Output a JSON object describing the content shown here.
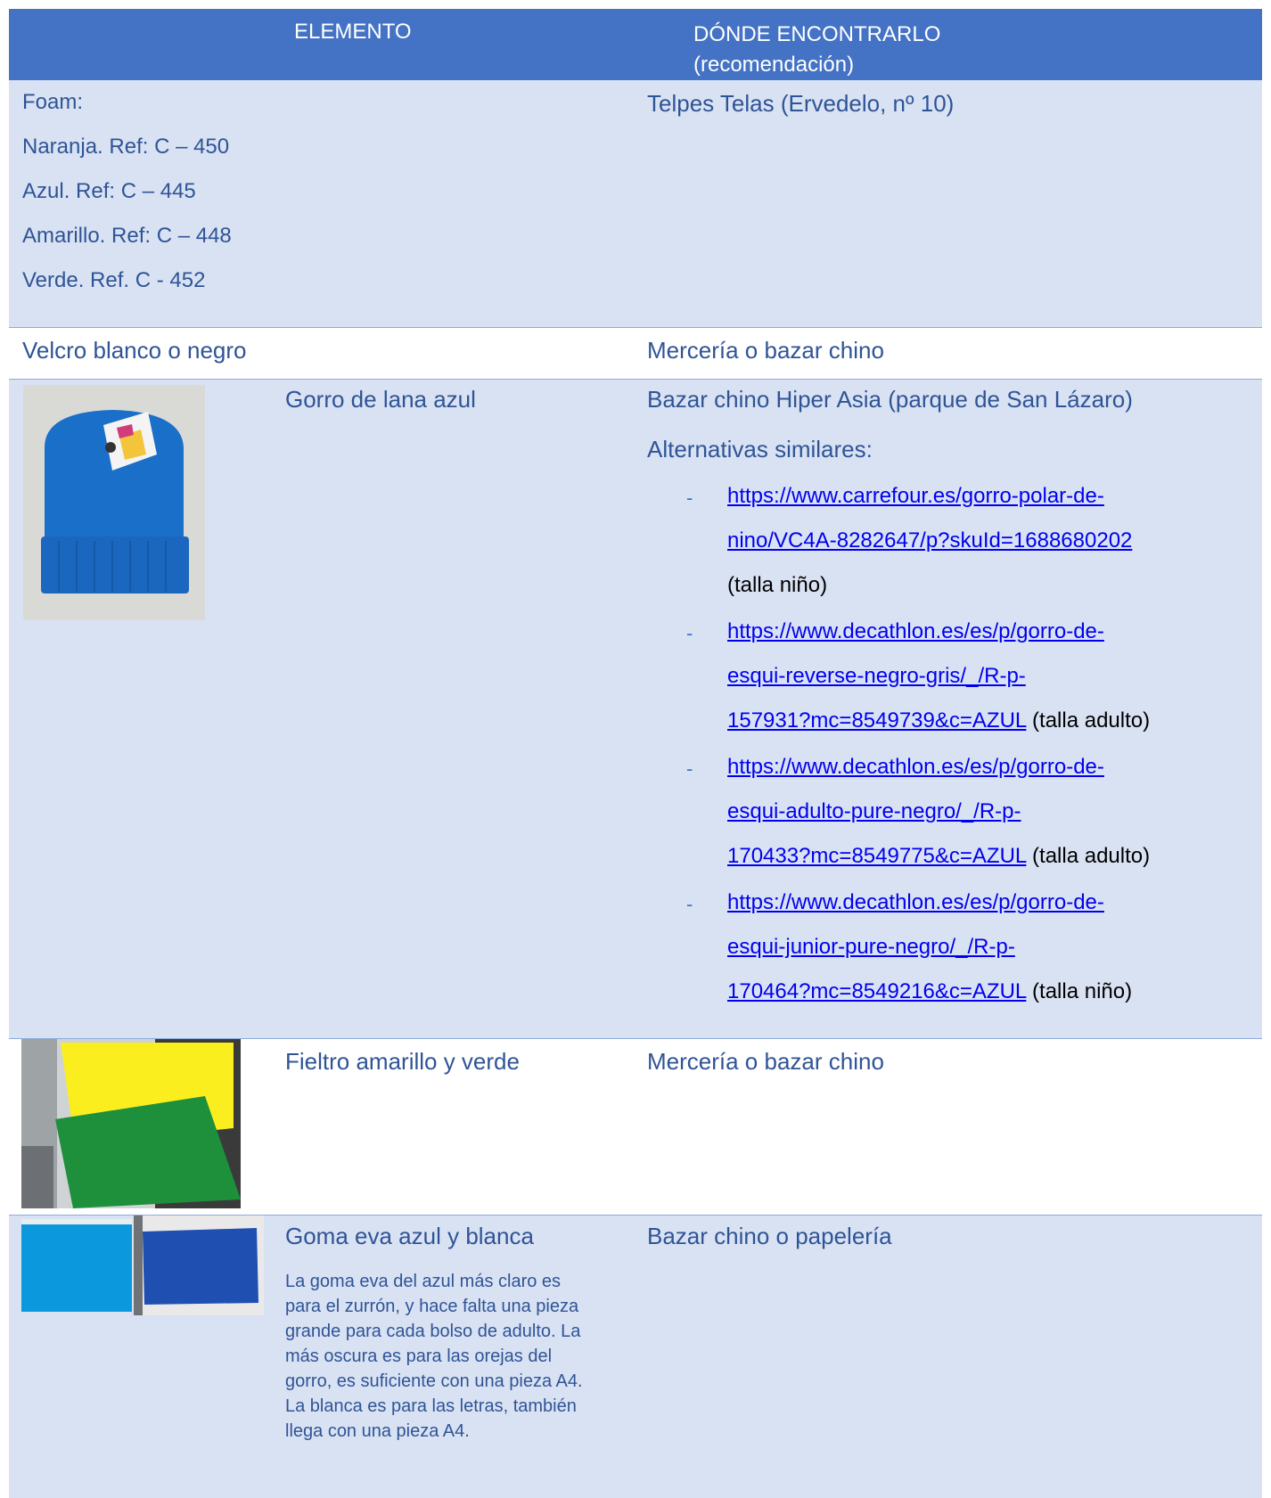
{
  "header": {
    "col1": "ELEMENTO",
    "col2_line1": "DÓNDE ENCONTRARLO",
    "col2_line2": "(recomendación)"
  },
  "foam": {
    "title": "Foam:",
    "items": [
      "Naranja. Ref: C – 450",
      "Azul. Ref: C – 445",
      "Amarillo. Ref: C – 448",
      "Verde. Ref. C - 452"
    ],
    "where": "Telpes Telas (Ervedelo, nº 10)"
  },
  "velcro": {
    "name": "Velcro blanco o negro",
    "where": "Mercería o bazar chino"
  },
  "gorro": {
    "name": "Gorro de lana azul",
    "where": "Bazar chino Hiper Asia (parque de San Lázaro)",
    "alt_label": "Alternativas similares:",
    "links": [
      {
        "lines": [
          "https://www.carrefour.es/gorro-polar-de-",
          "nino/VC4A-8282647/p?skuId=1688680202"
        ],
        "note": "(talla niño)"
      },
      {
        "lines": [
          "https://www.decathlon.es/es/p/gorro-de-",
          "esqui-reverse-negro-gris/_/R-p-",
          "157931?mc=8549739&c=AZUL"
        ],
        "note": "(talla adulto)"
      },
      {
        "lines": [
          "https://www.decathlon.es/es/p/gorro-de-",
          "esqui-adulto-pure-negro/_/R-p-",
          "170433?mc=8549775&c=AZUL"
        ],
        "note": "(talla adulto)"
      },
      {
        "lines": [
          "https://www.decathlon.es/es/p/gorro-de-",
          "esqui-junior-pure-negro/_/R-p-",
          "170464?mc=8549216&c=AZUL"
        ],
        "note": "(talla niño)"
      }
    ]
  },
  "fieltro": {
    "name": "Fieltro amarillo y verde",
    "where": "Mercería o bazar chino"
  },
  "goma": {
    "name": "Goma eva azul y blanca",
    "where": "Bazar chino o papelería",
    "desc": [
      "La goma eva del azul más claro es",
      "para el zurrón, y hace falta una pieza",
      "grande para cada bolso de adulto. La",
      "más oscura es para las orejas del",
      "gorro, es suficiente con una pieza A4.",
      "La blanca es para las letras, también",
      "llega con una pieza A4."
    ]
  },
  "colors": {
    "header_bg": "#4472c4",
    "band_bg": "#d9e2f3",
    "text": "#2f5496",
    "link": "#0000ee"
  }
}
